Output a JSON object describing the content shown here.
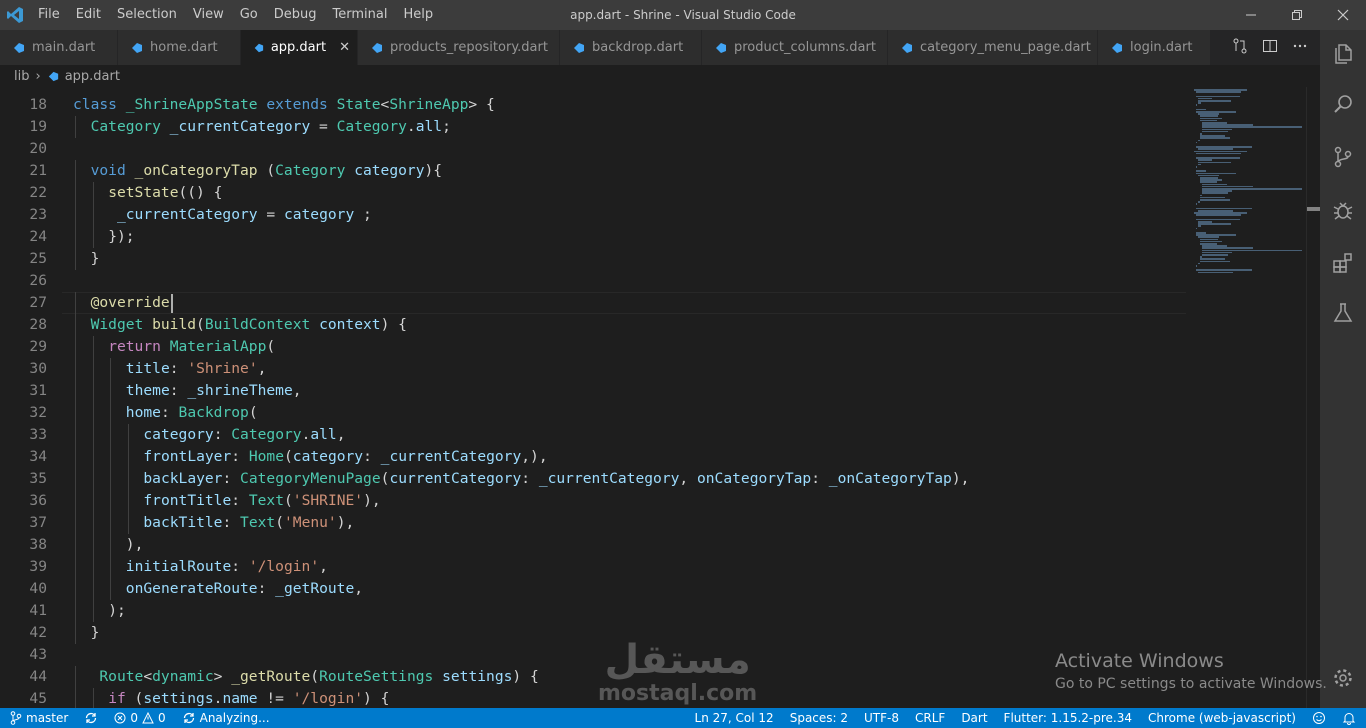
{
  "titlebar": {
    "menus": [
      "File",
      "Edit",
      "Selection",
      "View",
      "Go",
      "Debug",
      "Terminal",
      "Help"
    ],
    "title": "app.dart - Shrine - Visual Studio Code"
  },
  "tabs": [
    {
      "label": "main.dart",
      "active": false
    },
    {
      "label": "home.dart",
      "active": false
    },
    {
      "label": "app.dart",
      "active": true
    },
    {
      "label": "products_repository.dart",
      "active": false
    },
    {
      "label": "backdrop.dart",
      "active": false
    },
    {
      "label": "product_columns.dart",
      "active": false
    },
    {
      "label": "category_menu_page.dart",
      "active": false
    },
    {
      "label": "login.dart",
      "active": false
    }
  ],
  "breadcrumb": {
    "folder": "lib",
    "separator": "›",
    "file": "app.dart"
  },
  "editor": {
    "lines": [
      {
        "n": "18",
        "indent": 0,
        "tokens": [
          [
            "k",
            "class "
          ],
          [
            "t",
            "_ShrineAppState "
          ],
          [
            "k",
            "extends "
          ],
          [
            "t",
            "State"
          ],
          [
            "p",
            "<"
          ],
          [
            "t",
            "ShrineApp"
          ],
          [
            "p",
            "> {"
          ]
        ]
      },
      {
        "n": "19",
        "indent": 1,
        "tokens": [
          [
            "t",
            "Category "
          ],
          [
            "v",
            "_currentCategory "
          ],
          [
            "p",
            "= "
          ],
          [
            "t",
            "Category"
          ],
          [
            "p",
            "."
          ],
          [
            "v",
            "all"
          ],
          [
            "p",
            ";"
          ]
        ]
      },
      {
        "n": "20",
        "indent": 0,
        "tokens": []
      },
      {
        "n": "21",
        "indent": 1,
        "tokens": [
          [
            "k",
            "void "
          ],
          [
            "f",
            "_onCategoryTap "
          ],
          [
            "p",
            "("
          ],
          [
            "t",
            "Category "
          ],
          [
            "v",
            "category"
          ],
          [
            "p",
            "){"
          ]
        ]
      },
      {
        "n": "22",
        "indent": 2,
        "tokens": [
          [
            "f",
            "setState"
          ],
          [
            "p",
            "(() {"
          ]
        ]
      },
      {
        "n": "23",
        "indent": 2,
        "tokens": [
          [
            "p",
            " "
          ],
          [
            "v",
            "_currentCategory "
          ],
          [
            "p",
            "= "
          ],
          [
            "v",
            "category "
          ],
          [
            "p",
            ";"
          ]
        ]
      },
      {
        "n": "24",
        "indent": 2,
        "tokens": [
          [
            "p",
            "});"
          ]
        ]
      },
      {
        "n": "25",
        "indent": 1,
        "tokens": [
          [
            "p",
            "}"
          ]
        ]
      },
      {
        "n": "26",
        "indent": 0,
        "tokens": []
      },
      {
        "n": "27",
        "indent": 1,
        "tokens": [
          [
            "dec",
            "@override"
          ]
        ]
      },
      {
        "n": "28",
        "indent": 1,
        "tokens": [
          [
            "t",
            "Widget "
          ],
          [
            "f",
            "build"
          ],
          [
            "p",
            "("
          ],
          [
            "t",
            "BuildContext "
          ],
          [
            "v",
            "context"
          ],
          [
            "p",
            ") {"
          ]
        ]
      },
      {
        "n": "29",
        "indent": 2,
        "tokens": [
          [
            "c",
            "return "
          ],
          [
            "t",
            "MaterialApp"
          ],
          [
            "p",
            "("
          ]
        ]
      },
      {
        "n": "30",
        "indent": 3,
        "tokens": [
          [
            "v",
            "title"
          ],
          [
            "p",
            ": "
          ],
          [
            "s",
            "'Shrine'"
          ],
          [
            "p",
            ","
          ]
        ]
      },
      {
        "n": "31",
        "indent": 3,
        "tokens": [
          [
            "v",
            "theme"
          ],
          [
            "p",
            ": "
          ],
          [
            "v",
            "_shrineTheme"
          ],
          [
            "p",
            ","
          ]
        ]
      },
      {
        "n": "32",
        "indent": 3,
        "tokens": [
          [
            "v",
            "home"
          ],
          [
            "p",
            ": "
          ],
          [
            "t",
            "Backdrop"
          ],
          [
            "p",
            "("
          ]
        ]
      },
      {
        "n": "33",
        "indent": 4,
        "tokens": [
          [
            "v",
            "category"
          ],
          [
            "p",
            ": "
          ],
          [
            "t",
            "Category"
          ],
          [
            "p",
            "."
          ],
          [
            "v",
            "all"
          ],
          [
            "p",
            ","
          ]
        ]
      },
      {
        "n": "34",
        "indent": 4,
        "tokens": [
          [
            "v",
            "frontLayer"
          ],
          [
            "p",
            ": "
          ],
          [
            "t",
            "Home"
          ],
          [
            "p",
            "("
          ],
          [
            "v",
            "category"
          ],
          [
            "p",
            ": "
          ],
          [
            "v",
            "_currentCategory"
          ],
          [
            "p",
            ",),"
          ]
        ]
      },
      {
        "n": "35",
        "indent": 4,
        "tokens": [
          [
            "v",
            "backLayer"
          ],
          [
            "p",
            ": "
          ],
          [
            "t",
            "CategoryMenuPage"
          ],
          [
            "p",
            "("
          ],
          [
            "v",
            "currentCategory"
          ],
          [
            "p",
            ": "
          ],
          [
            "v",
            "_currentCategory"
          ],
          [
            "p",
            ", "
          ],
          [
            "v",
            "onCategoryTap"
          ],
          [
            "p",
            ": "
          ],
          [
            "v",
            "_onCategoryTap"
          ],
          [
            "p",
            "),"
          ]
        ]
      },
      {
        "n": "36",
        "indent": 4,
        "tokens": [
          [
            "v",
            "frontTitle"
          ],
          [
            "p",
            ": "
          ],
          [
            "t",
            "Text"
          ],
          [
            "p",
            "("
          ],
          [
            "s",
            "'SHRINE'"
          ],
          [
            "p",
            "),"
          ]
        ]
      },
      {
        "n": "37",
        "indent": 4,
        "tokens": [
          [
            "v",
            "backTitle"
          ],
          [
            "p",
            ": "
          ],
          [
            "t",
            "Text"
          ],
          [
            "p",
            "("
          ],
          [
            "s",
            "'Menu'"
          ],
          [
            "p",
            "),"
          ]
        ]
      },
      {
        "n": "38",
        "indent": 3,
        "tokens": [
          [
            "p",
            "),"
          ]
        ]
      },
      {
        "n": "39",
        "indent": 3,
        "tokens": [
          [
            "v",
            "initialRoute"
          ],
          [
            "p",
            ": "
          ],
          [
            "s",
            "'/login'"
          ],
          [
            "p",
            ","
          ]
        ]
      },
      {
        "n": "40",
        "indent": 3,
        "tokens": [
          [
            "v",
            "onGenerateRoute"
          ],
          [
            "p",
            ": "
          ],
          [
            "v",
            "_getRoute"
          ],
          [
            "p",
            ","
          ]
        ]
      },
      {
        "n": "41",
        "indent": 2,
        "tokens": [
          [
            "p",
            ");"
          ]
        ]
      },
      {
        "n": "42",
        "indent": 1,
        "tokens": [
          [
            "p",
            "}"
          ]
        ]
      },
      {
        "n": "43",
        "indent": 0,
        "tokens": []
      },
      {
        "n": "44",
        "indent": 1,
        "tokens": [
          [
            "p",
            " "
          ],
          [
            "t",
            "Route"
          ],
          [
            "p",
            "<"
          ],
          [
            "t",
            "dynamic"
          ],
          [
            "p",
            "> "
          ],
          [
            "f",
            "_getRoute"
          ],
          [
            "p",
            "("
          ],
          [
            "t",
            "RouteSettings "
          ],
          [
            "v",
            "settings"
          ],
          [
            "p",
            ") {"
          ]
        ]
      },
      {
        "n": "45",
        "indent": 2,
        "tokens": [
          [
            "c",
            "if "
          ],
          [
            "p",
            "("
          ],
          [
            "v",
            "settings"
          ],
          [
            "p",
            "."
          ],
          [
            "v",
            "name "
          ],
          [
            "p",
            "!= "
          ],
          [
            "s",
            "'/login'"
          ],
          [
            "p",
            ") {"
          ]
        ]
      }
    ]
  },
  "statusbar": {
    "branch": "master",
    "errors": "0",
    "warnings": "0",
    "analyzing": "Analyzing...",
    "position": "Ln 27, Col 12",
    "spaces": "Spaces: 2",
    "encoding": "UTF-8",
    "eol": "CRLF",
    "language": "Dart",
    "flutter": "Flutter: 1.15.2-pre.34",
    "device": "Chrome (web-javascript)"
  },
  "watermark": {
    "activate_title": "Activate Windows",
    "activate_sub": "Go to PC settings to activate Windows.",
    "brand_ar": "مستقل",
    "brand_url": "mostaql.com"
  },
  "colors": {
    "accent": "#007acc",
    "dart_icon": "#42a5f5",
    "keyword": "#569cd6",
    "type": "#4ec9b0",
    "function": "#dcdcaa",
    "variable": "#9cdcfe",
    "string": "#ce9178"
  },
  "icons": {
    "activity": [
      "files-icon",
      "search-icon",
      "source-control-icon",
      "debug-icon",
      "extensions-icon",
      "flask-icon",
      "gear-icon"
    ]
  }
}
